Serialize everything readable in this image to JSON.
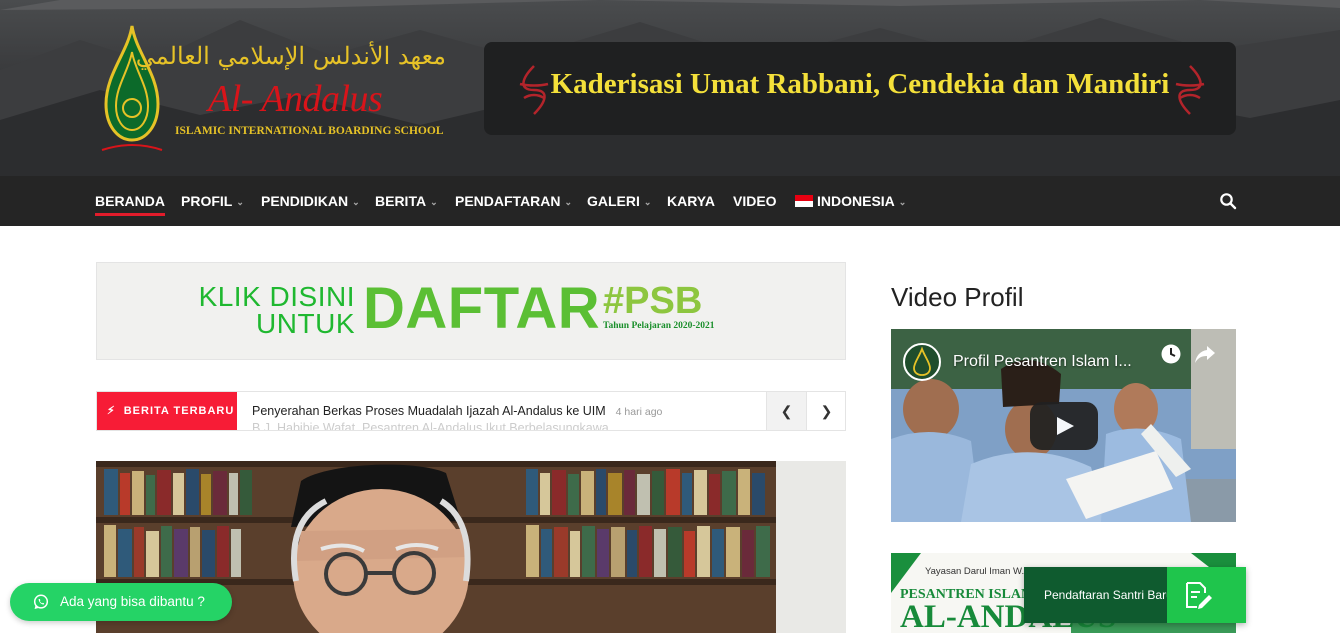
{
  "header": {
    "logo_arabic": "معهد الأندلس الإسلامي العالمي",
    "logo_name": "Al- Andalus",
    "logo_subtitle": "ISLAMIC INTERNATIONAL BOARDING SCHOOL",
    "tagline": "Kaderisasi Umat Rabbani, Cendekia dan Mandiri"
  },
  "nav": {
    "items": [
      {
        "label": "BERANDA",
        "dropdown": false,
        "active": true
      },
      {
        "label": "PROFIL",
        "dropdown": true
      },
      {
        "label": "PENDIDIKAN",
        "dropdown": true
      },
      {
        "label": "BERITA",
        "dropdown": true
      },
      {
        "label": "PENDAFTARAN",
        "dropdown": true
      },
      {
        "label": "GALERI",
        "dropdown": true
      },
      {
        "label": "KARYA",
        "dropdown": false
      },
      {
        "label": "VIDEO",
        "dropdown": false
      },
      {
        "label": "INDONESIA",
        "dropdown": true,
        "flag": "indonesia-flag"
      }
    ],
    "search_icon": "search-icon"
  },
  "banner": {
    "line1": "KLIK DISINI",
    "line2": "UNTUK",
    "daftar": "DAFTAR",
    "psb": "#PSB",
    "year": "Tahun Pelajaran 2020-2021"
  },
  "ticker": {
    "label": "BERITA TERBARU",
    "title": "Penyerahan Berkas Proses Muadalah Ijazah Al-Andalus ke UIM",
    "time": "4 hari ago",
    "next_title": "B.J. Habibie Wafat, Pesantren Al-Andalus Ikut Berbelasungkawa"
  },
  "sidebar": {
    "title": "Video Profil",
    "video_title": "Profil Pesantren Islam I...",
    "ad_org": "Yayasan Darul Iman W...",
    "ad_line": "PESANTREN ISLAM INTER...",
    "ad_name": "AL-ANDALUS"
  },
  "floating": {
    "psb_label": "Pendaftaran Santri Baru",
    "whatsapp_label": "Ada yang bisa dibantu ?"
  },
  "colors": {
    "accent_red": "#e21c2b",
    "ticker_red": "#f71c36",
    "nav_bg": "#252525",
    "whatsapp_green": "#25d366",
    "psb_green": "#0f5b2f"
  }
}
